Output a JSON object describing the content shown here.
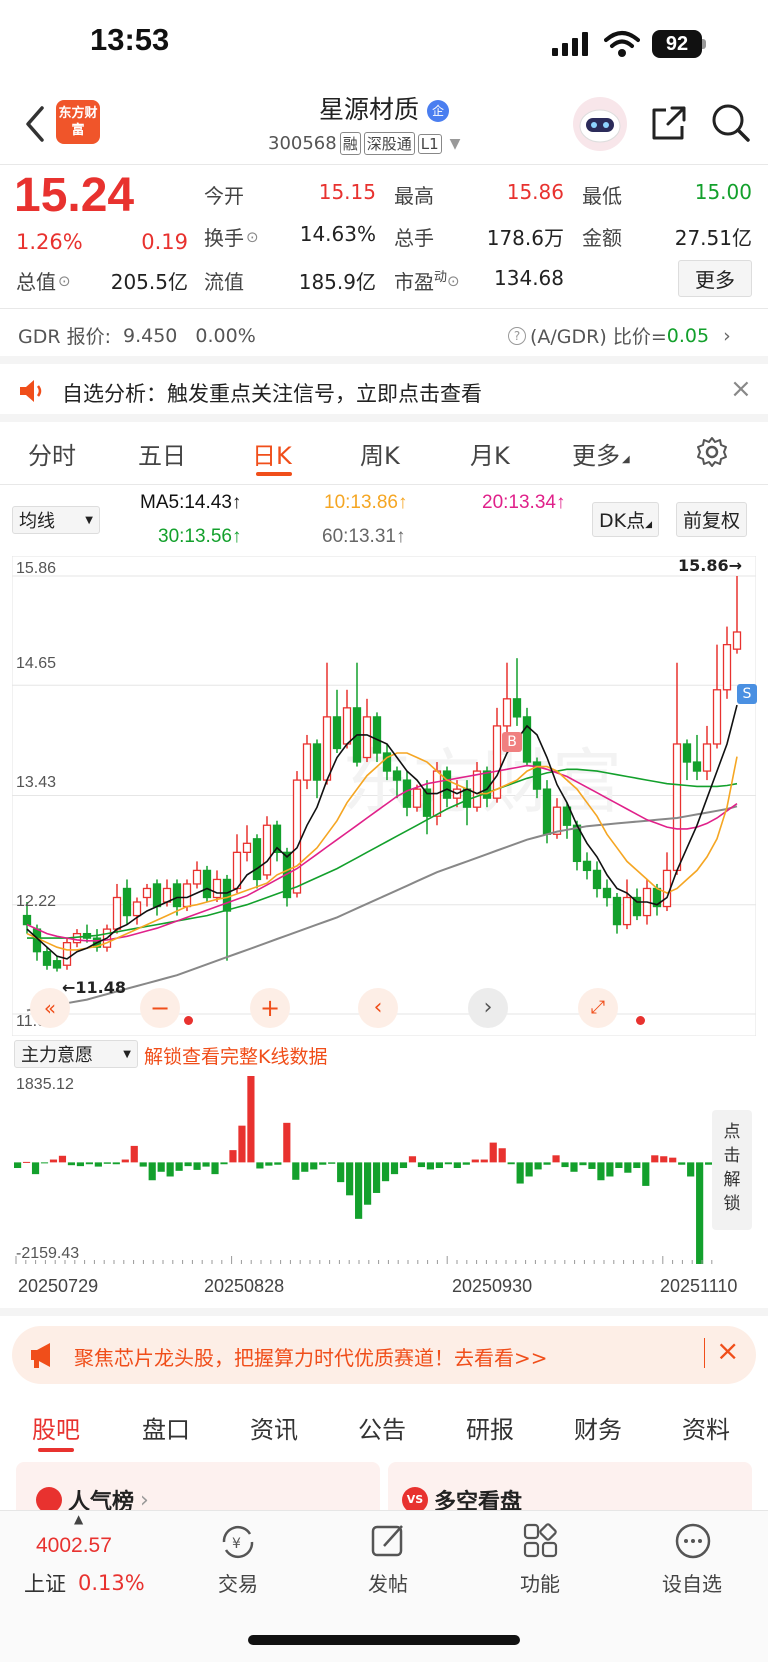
{
  "status_bar": {
    "time": "13:53",
    "battery": "92"
  },
  "header": {
    "logo_text": "东方财富",
    "title": "星源材质",
    "badge": "企",
    "code": "300568",
    "tags": [
      "融",
      "深股通",
      "L1"
    ]
  },
  "quote": {
    "price": "15.24",
    "change_pct": "1.26%",
    "change": "0.19",
    "rows": [
      [
        {
          "label": "今开",
          "value": "15.15",
          "color": "red"
        },
        {
          "label": "最高",
          "value": "15.86",
          "color": "red"
        },
        {
          "label": "最低",
          "value": "15.00",
          "color": "green"
        }
      ],
      [
        {
          "label": "换手",
          "value": "14.63%",
          "color": "black"
        },
        {
          "label": "总手",
          "value": "178.6万",
          "color": "black"
        },
        {
          "label": "金额",
          "value": "27.51亿",
          "color": "black"
        }
      ]
    ],
    "row3": {
      "zongzhi_label": "总值",
      "zongzhi": "205.5亿",
      "liuzhi_label": "流值",
      "liuzhi": "185.9亿",
      "pe_label": "市盈",
      "pe_sup": "动",
      "pe": "134.68"
    },
    "more_button": "更多"
  },
  "gdr": {
    "label": "GDR 报价:",
    "price": "9.450",
    "pct": "0.00%",
    "ratio_label": "(A/GDR) 比价=",
    "ratio": "0.05"
  },
  "alert": {
    "text": "自选分析：触发重点关注信号，立即点击查看"
  },
  "kline_tabs": [
    {
      "label": "分时",
      "active": false
    },
    {
      "label": "五日",
      "active": false
    },
    {
      "label": "日K",
      "active": true
    },
    {
      "label": "周K",
      "active": false
    },
    {
      "label": "月K",
      "active": false
    },
    {
      "label": "更多",
      "active": false
    }
  ],
  "ma_bar": {
    "selector": "均线",
    "ma5": "MA5:14.43",
    "ma10": "10:13.86",
    "ma20": "20:13.34",
    "ma30": "30:13.56",
    "ma60": "60:13.31",
    "dk_button": "DK点",
    "fq_button": "前复权",
    "colors": {
      "ma5": "#111111",
      "ma10": "#f5a623",
      "ma20": "#e0218a",
      "ma30": "#13a02c",
      "ma60": "#888888"
    }
  },
  "chart_labels": {
    "y_ticks": [
      "15.86",
      "14.65",
      "13.43",
      "12.22",
      "11.01"
    ],
    "high_marker": "15.86",
    "low_marker": "11.48",
    "b_marker": "B",
    "s_marker": "S"
  },
  "indicator": {
    "selector": "主力意愿",
    "unlock_text": "解锁查看完整K线数据",
    "max": "1835.12",
    "min": "-2159.43",
    "side_unlock": [
      "点",
      "击",
      "解",
      "锁"
    ]
  },
  "dates": [
    "20250729",
    "20250828",
    "20250930",
    "20251110"
  ],
  "banner": {
    "text": "聚焦芯片龙头股，把握算力时代优质赛道！去看看>>"
  },
  "bottom_tabs": [
    {
      "label": "股吧",
      "active": true
    },
    {
      "label": "盘口",
      "active": false
    },
    {
      "label": "资讯",
      "active": false
    },
    {
      "label": "公告",
      "active": false
    },
    {
      "label": "研报",
      "active": false
    },
    {
      "label": "财务",
      "active": false
    },
    {
      "label": "资料",
      "active": false
    }
  ],
  "cards": {
    "left": "人气榜",
    "right": "多空看盘"
  },
  "bottom_nav": {
    "index_value": "4002.57",
    "index_name": "上证",
    "index_pct": "0.13%",
    "items": [
      "交易",
      "发帖",
      "功能",
      "设自选"
    ]
  },
  "chart_data": {
    "type": "candlestick",
    "ylim": [
      11.01,
      15.86
    ],
    "y_ticks": [
      15.86,
      14.65,
      13.43,
      12.22,
      11.01
    ],
    "candles": [
      [
        12.1,
        12.0,
        12.25,
        11.9
      ],
      [
        11.95,
        11.7,
        12.0,
        11.6
      ],
      [
        11.7,
        11.55,
        11.75,
        11.5
      ],
      [
        11.6,
        11.52,
        11.65,
        11.48
      ],
      [
        11.55,
        11.8,
        11.85,
        11.5
      ],
      [
        11.8,
        11.9,
        11.95,
        11.75
      ],
      [
        11.9,
        11.85,
        12.0,
        11.8
      ],
      [
        11.85,
        11.75,
        11.95,
        11.7
      ],
      [
        11.75,
        11.95,
        12.0,
        11.7
      ],
      [
        11.95,
        12.3,
        12.45,
        11.9
      ],
      [
        12.4,
        12.1,
        12.5,
        12.0
      ],
      [
        12.1,
        12.25,
        12.3,
        12.0
      ],
      [
        12.3,
        12.4,
        12.45,
        12.2
      ],
      [
        12.45,
        12.2,
        12.5,
        12.1
      ],
      [
        12.25,
        12.4,
        12.5,
        12.2
      ],
      [
        12.45,
        12.2,
        12.5,
        12.1
      ],
      [
        12.2,
        12.45,
        12.5,
        12.15
      ],
      [
        12.45,
        12.6,
        12.7,
        12.4
      ],
      [
        12.6,
        12.3,
        12.65,
        12.25
      ],
      [
        12.3,
        12.5,
        12.6,
        12.25
      ],
      [
        12.5,
        12.15,
        12.55,
        11.6
      ],
      [
        12.4,
        12.8,
        13.0,
        12.35
      ],
      [
        12.8,
        12.9,
        13.1,
        12.7
      ],
      [
        12.95,
        12.5,
        13.0,
        12.4
      ],
      [
        12.55,
        13.1,
        13.2,
        12.5
      ],
      [
        13.1,
        12.8,
        13.15,
        12.7
      ],
      [
        12.8,
        12.3,
        12.85,
        12.2
      ],
      [
        12.35,
        13.6,
        13.7,
        12.3
      ],
      [
        13.6,
        14.0,
        14.1,
        13.5
      ],
      [
        14.0,
        13.6,
        14.05,
        13.4
      ],
      [
        13.6,
        14.3,
        14.9,
        13.55
      ],
      [
        14.3,
        13.95,
        14.6,
        13.9
      ],
      [
        14.0,
        14.4,
        14.6,
        13.95
      ],
      [
        14.4,
        13.8,
        14.9,
        13.75
      ],
      [
        13.85,
        14.3,
        14.5,
        13.8
      ],
      [
        14.3,
        13.9,
        14.35,
        13.8
      ],
      [
        13.9,
        13.7,
        14.0,
        13.6
      ],
      [
        13.7,
        13.6,
        13.75,
        13.4
      ],
      [
        13.6,
        13.3,
        13.7,
        13.2
      ],
      [
        13.3,
        13.5,
        13.55,
        13.25
      ],
      [
        13.5,
        13.2,
        13.6,
        13.0
      ],
      [
        13.2,
        13.7,
        13.8,
        13.1
      ],
      [
        13.7,
        13.4,
        13.75,
        13.3
      ],
      [
        13.4,
        13.5,
        13.6,
        13.3
      ],
      [
        13.5,
        13.3,
        13.6,
        13.1
      ],
      [
        13.3,
        13.7,
        13.8,
        13.25
      ],
      [
        13.7,
        13.4,
        13.75,
        13.3
      ],
      [
        13.4,
        14.2,
        14.4,
        13.35
      ],
      [
        14.2,
        14.5,
        14.9,
        14.1
      ],
      [
        14.5,
        14.3,
        14.95,
        14.2
      ],
      [
        14.3,
        13.8,
        14.4,
        13.75
      ],
      [
        13.8,
        13.5,
        13.85,
        13.4
      ],
      [
        13.5,
        13.0,
        13.6,
        12.9
      ],
      [
        13.0,
        13.3,
        13.4,
        12.95
      ],
      [
        13.3,
        13.1,
        13.35,
        12.95
      ],
      [
        13.1,
        12.7,
        13.15,
        12.6
      ],
      [
        12.7,
        12.6,
        12.8,
        12.5
      ],
      [
        12.6,
        12.4,
        12.7,
        12.3
      ],
      [
        12.4,
        12.3,
        12.5,
        12.2
      ],
      [
        12.3,
        12.0,
        12.35,
        11.9
      ],
      [
        12.0,
        12.3,
        12.5,
        11.95
      ],
      [
        12.3,
        12.1,
        12.4,
        12.05
      ],
      [
        12.1,
        12.4,
        12.5,
        12.0
      ],
      [
        12.4,
        12.2,
        12.45,
        12.1
      ],
      [
        12.2,
        12.6,
        12.8,
        12.15
      ],
      [
        12.6,
        14.0,
        14.9,
        12.55
      ],
      [
        14.0,
        13.8,
        14.05,
        13.6
      ],
      [
        13.8,
        13.7,
        14.1,
        13.6
      ],
      [
        13.7,
        14.0,
        14.2,
        13.6
      ],
      [
        14.0,
        14.6,
        15.1,
        13.95
      ],
      [
        14.6,
        15.1,
        15.3,
        14.5
      ],
      [
        15.05,
        15.24,
        15.86,
        15.0
      ]
    ],
    "ma5": [
      11.95,
      11.85,
      11.75,
      11.65,
      11.62,
      11.7,
      11.74,
      11.8,
      11.85,
      11.95,
      12.0,
      12.08,
      12.15,
      12.2,
      12.25,
      12.3,
      12.3,
      12.35,
      12.4,
      12.35,
      12.35,
      12.4,
      12.55,
      12.62,
      12.7,
      12.85,
      12.75,
      12.85,
      13.1,
      13.3,
      13.6,
      13.85,
      14.0,
      14.1,
      14.1,
      14.05,
      14.0,
      13.85,
      13.7,
      13.6,
      13.45,
      13.45,
      13.5,
      13.45,
      13.5,
      13.45,
      13.5,
      13.65,
      13.9,
      14.05,
      14.2,
      14.1,
      13.85,
      13.55,
      13.35,
      13.1,
      12.9,
      12.75,
      12.55,
      12.4,
      12.35,
      12.25,
      12.25,
      12.22,
      12.3,
      12.6,
      12.85,
      13.1,
      13.4,
      13.7,
      14.0,
      14.43
    ],
    "ma10": [
      11.9,
      11.85,
      11.8,
      11.75,
      11.72,
      11.72,
      11.74,
      11.76,
      11.8,
      11.85,
      11.9,
      11.95,
      12.0,
      12.05,
      12.1,
      12.15,
      12.2,
      12.22,
      12.25,
      12.28,
      12.3,
      12.34,
      12.38,
      12.42,
      12.46,
      12.55,
      12.6,
      12.65,
      12.75,
      12.85,
      13.0,
      13.15,
      13.35,
      13.5,
      13.65,
      13.75,
      13.85,
      13.9,
      13.9,
      13.85,
      13.8,
      13.7,
      13.6,
      13.55,
      13.5,
      13.45,
      13.45,
      13.5,
      13.55,
      13.6,
      13.7,
      13.75,
      13.75,
      13.7,
      13.6,
      13.5,
      13.35,
      13.2,
      13.0,
      12.85,
      12.7,
      12.6,
      12.5,
      12.4,
      12.35,
      12.4,
      12.5,
      12.6,
      12.75,
      12.95,
      13.3,
      13.86
    ],
    "ma20": [
      12.0,
      11.95,
      11.9,
      11.87,
      11.85,
      11.83,
      11.82,
      11.82,
      11.83,
      11.85,
      11.87,
      11.9,
      11.93,
      11.96,
      12.0,
      12.04,
      12.08,
      12.12,
      12.16,
      12.2,
      12.24,
      12.28,
      12.32,
      12.38,
      12.44,
      12.5,
      12.56,
      12.62,
      12.7,
      12.78,
      12.86,
      12.94,
      13.02,
      13.1,
      13.18,
      13.26,
      13.34,
      13.42,
      13.48,
      13.52,
      13.56,
      13.58,
      13.6,
      13.62,
      13.64,
      13.66,
      13.68,
      13.7,
      13.72,
      13.74,
      13.76,
      13.75,
      13.72,
      13.68,
      13.64,
      13.58,
      13.52,
      13.46,
      13.4,
      13.34,
      13.28,
      13.22,
      13.16,
      13.12,
      13.08,
      13.06,
      13.06,
      13.08,
      13.12,
      13.18,
      13.26,
      13.34
    ],
    "ma30": [
      11.85,
      11.85,
      11.85,
      11.85,
      11.85,
      11.86,
      11.87,
      11.88,
      11.9,
      11.92,
      11.94,
      11.96,
      11.98,
      12.0,
      12.02,
      12.04,
      12.06,
      12.08,
      12.1,
      12.13,
      12.16,
      12.19,
      12.22,
      12.26,
      12.3,
      12.34,
      12.38,
      12.42,
      12.47,
      12.52,
      12.57,
      12.62,
      12.68,
      12.74,
      12.8,
      12.86,
      12.92,
      12.98,
      13.04,
      13.1,
      13.16,
      13.22,
      13.28,
      13.33,
      13.38,
      13.42,
      13.46,
      13.5,
      13.54,
      13.58,
      13.62,
      13.65,
      13.68,
      13.7,
      13.72,
      13.72,
      13.71,
      13.7,
      13.68,
      13.66,
      13.64,
      13.62,
      13.6,
      13.58,
      13.56,
      13.55,
      13.54,
      13.53,
      13.53,
      13.53,
      13.54,
      13.56
    ],
    "ma60": [
      11.05,
      11.07,
      11.09,
      11.11,
      11.13,
      11.15,
      11.17,
      11.2,
      11.23,
      11.26,
      11.29,
      11.32,
      11.35,
      11.38,
      11.41,
      11.44,
      11.48,
      11.52,
      11.56,
      11.6,
      11.64,
      11.68,
      11.72,
      11.76,
      11.8,
      11.84,
      11.88,
      11.92,
      11.96,
      12.0,
      12.04,
      12.08,
      12.13,
      12.18,
      12.23,
      12.28,
      12.33,
      12.38,
      12.43,
      12.48,
      12.53,
      12.58,
      12.62,
      12.66,
      12.7,
      12.74,
      12.78,
      12.82,
      12.86,
      12.9,
      12.94,
      12.97,
      13.0,
      13.03,
      13.05,
      13.07,
      13.09,
      13.1,
      13.11,
      13.12,
      13.13,
      13.14,
      13.15,
      13.16,
      13.17,
      13.18,
      13.2,
      13.22,
      13.24,
      13.26,
      13.28,
      13.31
    ],
    "indicator_values": [
      -120,
      10,
      -250,
      -20,
      60,
      140,
      -60,
      -80,
      -40,
      -90,
      -30,
      -40,
      60,
      350,
      -90,
      -380,
      -200,
      -300,
      -180,
      -80,
      -160,
      -90,
      -250,
      -40,
      260,
      780,
      1835,
      -130,
      -70,
      -50,
      840,
      -370,
      -200,
      -150,
      -50,
      -30,
      -420,
      -700,
      -1200,
      -900,
      -650,
      -400,
      -250,
      -120,
      130,
      -100,
      -150,
      -120,
      -40,
      -120,
      -50,
      60,
      60,
      420,
      300,
      -40,
      -450,
      -300,
      -150,
      -50,
      150,
      -100,
      -200,
      -60,
      -140,
      -380,
      -300,
      -120,
      -220,
      -120,
      -500,
      150,
      130,
      100,
      -50,
      -300,
      -2159,
      -50
    ]
  }
}
